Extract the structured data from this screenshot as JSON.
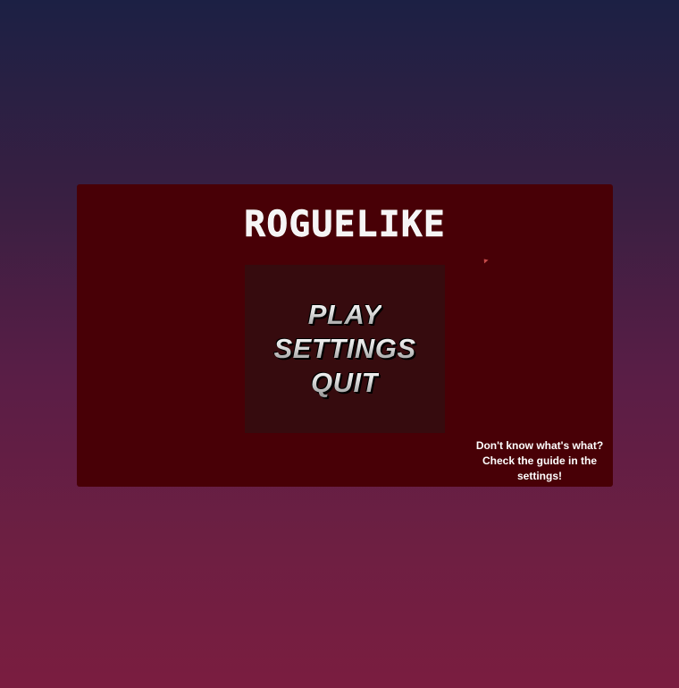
{
  "game": {
    "title": "ROGUELIKE"
  },
  "menu": {
    "items": [
      {
        "label": "PLAY"
      },
      {
        "label": "SETTINGS"
      },
      {
        "label": "QUIT"
      }
    ]
  },
  "hint": {
    "text": "Don't know what's what? Check the guide in the settings!"
  }
}
